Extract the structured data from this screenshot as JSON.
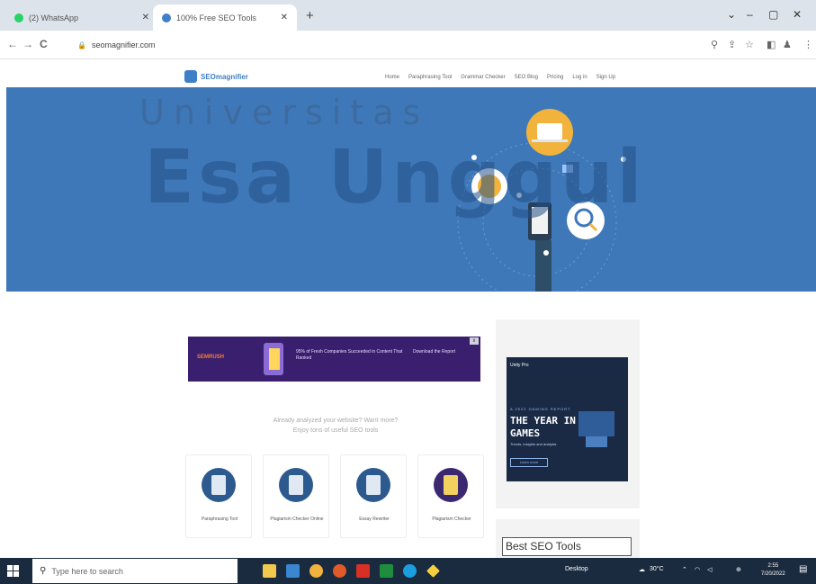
{
  "browser": {
    "tabs": [
      {
        "title": "(2) WhatsApp",
        "active": false,
        "favicon_color": "#25d366"
      },
      {
        "title": "100% Free SEO Tools",
        "active": true,
        "favicon_color": "#3f7fc8"
      }
    ],
    "new_tab": "+",
    "window_controls": {
      "minimize": "–",
      "restore": "▢",
      "close": "✕",
      "tab_search": "⌄"
    },
    "nav": {
      "back": "←",
      "forward": "→",
      "reload": "C"
    },
    "url": "seomagnifier.com",
    "toolbar_icons": [
      "search-icon",
      "share-icon",
      "star-icon",
      "extensions-icon",
      "profile-icon",
      "menu-icon"
    ]
  },
  "site": {
    "logo_text": "SEOmagnifier",
    "nav_links": [
      "Home",
      "Paraphrasing Tool",
      "Grammar Checker",
      "SEO Blog",
      "Pricing",
      "Log in",
      "Sign Up"
    ],
    "brand_color": "#3f78b8"
  },
  "watermark": {
    "line1": "Universitas",
    "line2": "Esa Unggul"
  },
  "ad_banner": {
    "brand": "SEMRUSH",
    "blurb": "95% of Fresh Companies Succeeded in Content That Ranked",
    "cta": "Download the Report",
    "close": "x"
  },
  "tagline": {
    "line1": "Already analyzed your website? Want more?",
    "line2": "Enjoy tons of useful SEO tools"
  },
  "tools": [
    {
      "label": "Paraphrasing Tool"
    },
    {
      "label": "Plagiarism Checker Online"
    },
    {
      "label": "Essay Rewriter"
    },
    {
      "label": "Plagiarism Checker"
    }
  ],
  "sidebar_ad": {
    "head": "Unity Pro",
    "eyebrow": "A 2022 GAMING REPORT",
    "headline": "THE YEAR IN GAMES",
    "sub": "Trends, insights and analysis",
    "button": "Learn more"
  },
  "sidebar_heading": "Best SEO Tools",
  "taskbar": {
    "search_placeholder": "Type here to search",
    "desktop_label": "Desktop",
    "weather": "30°C",
    "time": "2:55",
    "date": "7/20/2022"
  }
}
